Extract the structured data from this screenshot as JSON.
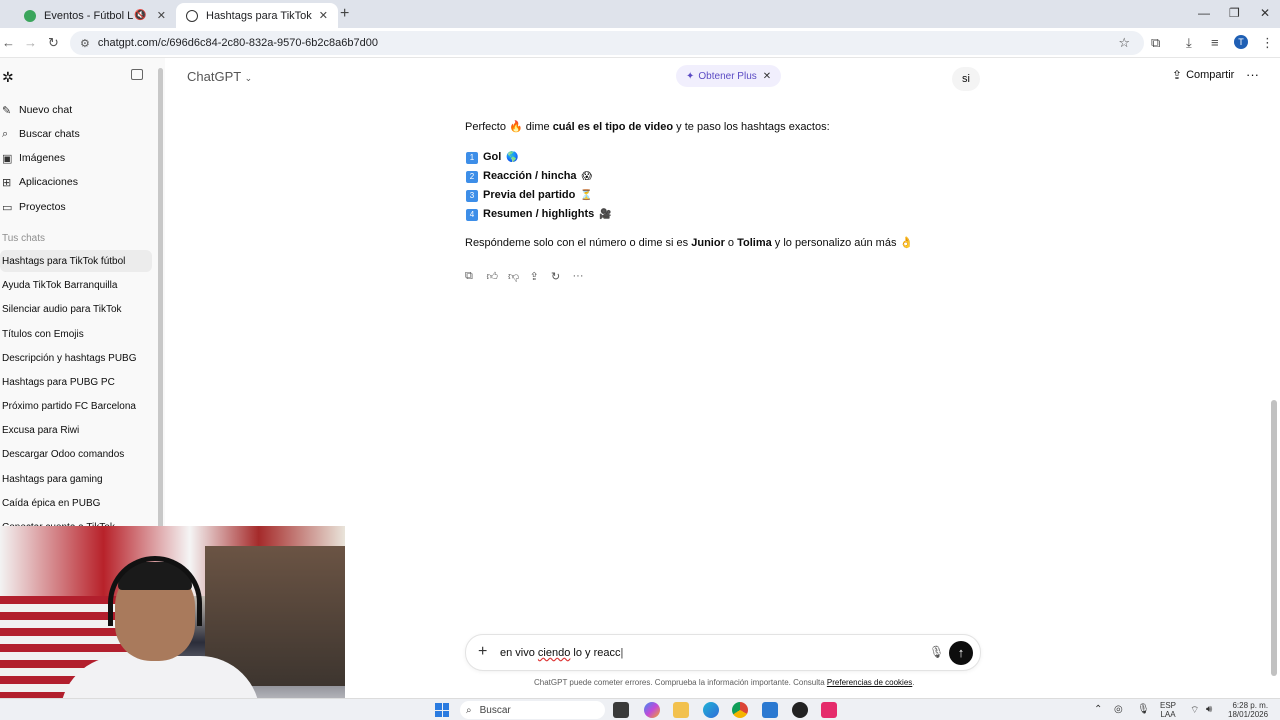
{
  "browser": {
    "tabs": [
      {
        "title": "Eventos - Fútbol Libre TV",
        "active": false
      },
      {
        "title": "Hashtags para TikTok fútbol",
        "active": true
      }
    ],
    "url": "chatgpt.com/c/696d6c84-2c80-832a-9570-6b2c8a6b7d00"
  },
  "sidebar": {
    "nav": [
      {
        "label": "Nuevo chat",
        "icon": "edit-icon"
      },
      {
        "label": "Buscar chats",
        "icon": "search-icon"
      },
      {
        "label": "Imágenes",
        "icon": "image-icon"
      },
      {
        "label": "Aplicaciones",
        "icon": "apps-icon"
      },
      {
        "label": "Proyectos",
        "icon": "folder-icon"
      }
    ],
    "section_label": "Tus chats",
    "chats": [
      "Hashtags para TikTok fútbol",
      "Ayuda TikTok Barranquilla",
      "Silenciar audio para TikTok",
      "Títulos con Emojis",
      "Descripción y hashtags PUBG",
      "Hashtags para PUBG PC",
      "Próximo partido FC Barcelona",
      "Excusa para Riwi",
      "Descargar Odoo comandos",
      "Hashtags para gaming",
      "Caída épica en PUBG",
      "Conectar cuenta a TikTok"
    ]
  },
  "header": {
    "model": "ChatGPT",
    "upgrade": "Obtener Plus",
    "share": "Compartir"
  },
  "conversation": {
    "user_message": "si",
    "assistant": {
      "intro_a": "Perfecto 🔥 dime ",
      "intro_b": "cuál es el tipo de video",
      "intro_c": " y te paso los hashtags exactos:",
      "options": [
        {
          "num": "1",
          "label": "Gol",
          "emoji": "🌎"
        },
        {
          "num": "2",
          "label": "Reacción / hincha",
          "emoji": "😱"
        },
        {
          "num": "3",
          "label": "Previa del partido",
          "emoji": "⏳"
        },
        {
          "num": "4",
          "label": "Resumen / highlights",
          "emoji": "🎥"
        }
      ],
      "outro_a": "Respóndeme solo con el número o dime si es ",
      "outro_b": "Junior",
      "outro_c": " o ",
      "outro_d": "Tolima",
      "outro_e": " y lo personalizo aún más 👌"
    }
  },
  "composer": {
    "text_a": "en vivo ",
    "text_b": "ciendo",
    "text_c": " lo y reacc"
  },
  "disclaimer": {
    "text": "ChatGPT puede cometer errores. Comprueba la información importante. Consulta ",
    "link": "Preferencias de cookies",
    "end": "."
  },
  "taskbar": {
    "search": "Buscar",
    "lang_1": "ESP",
    "lang_2": "LAA",
    "time": "6:28 p. m.",
    "date": "18/01/2026"
  }
}
